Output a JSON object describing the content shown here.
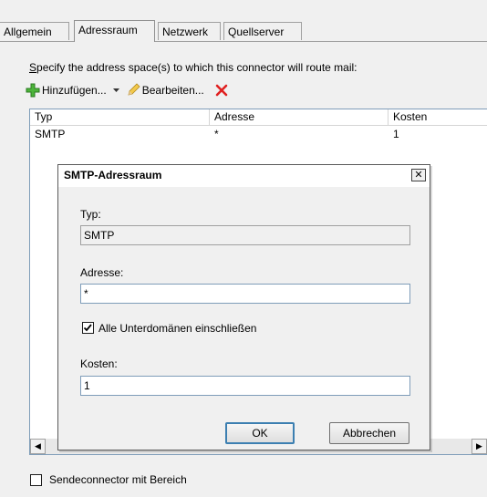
{
  "tabs": [
    {
      "label": "Allgemein"
    },
    {
      "label": "Adressraum"
    },
    {
      "label": "Netzwerk"
    },
    {
      "label": "Quellserver"
    }
  ],
  "description": {
    "prefix": "S",
    "text": "pecify the address space(s) to which this connector will route mail:"
  },
  "toolbar": {
    "add_label": "Hinzufügen...",
    "edit_label": "Bearbeiten...",
    "delete_icon": "red-x-icon",
    "add_icon": "green-plus-icon",
    "edit_icon": "pencil-icon"
  },
  "list": {
    "columns": [
      "Typ",
      "Adresse",
      "Kosten"
    ],
    "rows": [
      [
        "SMTP",
        "*",
        "1"
      ]
    ]
  },
  "dialog": {
    "title": "SMTP-Adressraum",
    "typ_label": "Typ:",
    "typ_value": "SMTP",
    "adresse_label": "Adresse:",
    "adresse_value": "*",
    "subdomains_label": "Alle Unterdomänen einschließen",
    "subdomains_checked": true,
    "kosten_label": "Kosten:",
    "kosten_value": "1",
    "ok_label": "OK",
    "cancel_label": "Abbrechen"
  },
  "bottom_checkbox": {
    "label": "Sendeconnector mit Bereich",
    "checked": false
  },
  "colors": {
    "window_bg": "#f0f0f0",
    "list_border": "#7f9db9",
    "default_button_border": "#3c7fb1"
  }
}
